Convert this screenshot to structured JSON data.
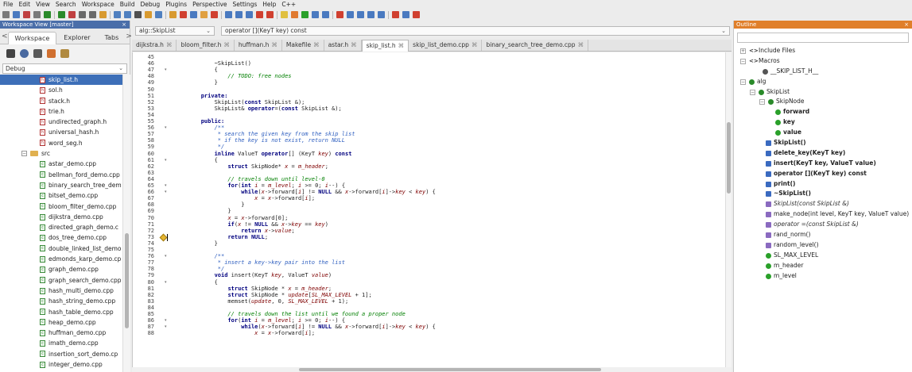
{
  "menubar": {
    "items": [
      "File",
      "Edit",
      "View",
      "Search",
      "Workspace",
      "Build",
      "Debug",
      "Plugins",
      "Perspective",
      "Settings",
      "Help",
      "C++"
    ]
  },
  "toolbar_colors": [
    "#7a7a7a",
    "#4a7ac0",
    "#c04040",
    "#7a7a7a",
    "#2a8a2a",
    "#2a8a2a",
    "#c04040",
    "#6a6a6a",
    "#6a6a6a",
    "#d89a30",
    "#5080c0",
    "#5080c0",
    "#505050",
    "#d89a30",
    "#5080c0",
    "#d89a30",
    "#d04030",
    "#4a7ac0",
    "#e0a040",
    "#d04030",
    "#4a7ac0",
    "#4a7ac0",
    "#4a7ac0",
    "#d04030",
    "#d04030",
    "#e0c040",
    "#e07a30",
    "#2aa02a",
    "#4a7ac0",
    "#4a7ac0",
    "#d04030",
    "#4a7ac0",
    "#4a7ac0",
    "#4a7ac0",
    "#4a7ac0",
    "#d04030",
    "#4a7ac0",
    "#d04030"
  ],
  "workspace": {
    "title": "Workspace View [master]",
    "close": "×",
    "tabs": [
      "Workspace",
      "Explorer",
      "Tabs"
    ],
    "tab_left_arrow": "<",
    "tab_right_arrow": ">",
    "config": "Debug",
    "tree": [
      {
        "kind": "h",
        "label": "skip_list.h",
        "indent": 50,
        "selected": true
      },
      {
        "kind": "h",
        "label": "sol.h",
        "indent": 50
      },
      {
        "kind": "h",
        "label": "stack.h",
        "indent": 50
      },
      {
        "kind": "h",
        "label": "trie.h",
        "indent": 50
      },
      {
        "kind": "h",
        "label": "undirected_graph.h",
        "indent": 50
      },
      {
        "kind": "h",
        "label": "universal_hash.h",
        "indent": 50
      },
      {
        "kind": "h",
        "label": "word_seg.h",
        "indent": 50
      },
      {
        "kind": "folder",
        "label": "src",
        "indent": 27,
        "expander": "−"
      },
      {
        "kind": "cpp",
        "label": "astar_demo.cpp",
        "indent": 50
      },
      {
        "kind": "cpp",
        "label": "bellman_ford_demo.cpp",
        "indent": 50
      },
      {
        "kind": "cpp",
        "label": "binary_search_tree_dem",
        "indent": 50
      },
      {
        "kind": "cpp",
        "label": "bitset_demo.cpp",
        "indent": 50
      },
      {
        "kind": "cpp",
        "label": "bloom_filter_demo.cpp",
        "indent": 50
      },
      {
        "kind": "cpp",
        "label": "dijkstra_demo.cpp",
        "indent": 50
      },
      {
        "kind": "cpp",
        "label": "directed_graph_demo.c",
        "indent": 50
      },
      {
        "kind": "cpp",
        "label": "dos_tree_demo.cpp",
        "indent": 50
      },
      {
        "kind": "cpp",
        "label": "double_linked_list_demo",
        "indent": 50
      },
      {
        "kind": "cpp",
        "label": "edmonds_karp_demo.cp",
        "indent": 50
      },
      {
        "kind": "cpp",
        "label": "graph_demo.cpp",
        "indent": 50
      },
      {
        "kind": "cpp",
        "label": "graph_search_demo.cpp",
        "indent": 50
      },
      {
        "kind": "cpp",
        "label": "hash_multi_demo.cpp",
        "indent": 50
      },
      {
        "kind": "cpp",
        "label": "hash_string_demo.cpp",
        "indent": 50
      },
      {
        "kind": "cpp",
        "label": "hash_table_demo.cpp",
        "indent": 50
      },
      {
        "kind": "cpp",
        "label": "heap_demo.cpp",
        "indent": 50
      },
      {
        "kind": "cpp",
        "label": "huffman_demo.cpp",
        "indent": 50
      },
      {
        "kind": "cpp",
        "label": "imath_demo.cpp",
        "indent": 50
      },
      {
        "kind": "cpp",
        "label": "insertion_sort_demo.cp",
        "indent": 50
      },
      {
        "kind": "cpp",
        "label": "integer_demo.cpp",
        "indent": 50
      }
    ]
  },
  "editor": {
    "scope": "alg::SkipList",
    "function": "operator [](KeyT key) const",
    "tabs": [
      {
        "label": "dijkstra.h"
      },
      {
        "label": "bloom_filter.h"
      },
      {
        "label": "huffman.h"
      },
      {
        "label": "Makefile"
      },
      {
        "label": "astar.h"
      },
      {
        "label": "skip_list.h",
        "active": true
      },
      {
        "label": "skip_list_demo.cpp"
      },
      {
        "label": "binary_search_tree_demo.cpp"
      }
    ],
    "tab_close": "⌘",
    "lines": [
      {
        "n": "45",
        "t": ""
      },
      {
        "n": "46",
        "t": "            ~SkipList()"
      },
      {
        "n": "47",
        "t": "            {",
        "fold": "▾"
      },
      {
        "n": "48",
        "t": "                // TODO: free nodes",
        "cls": "cm"
      },
      {
        "n": "49",
        "t": "            }"
      },
      {
        "n": "50",
        "t": ""
      },
      {
        "n": "51",
        "t": "        private:",
        "cls": "kw"
      },
      {
        "n": "52",
        "t": "            SkipList(const SkipList &);"
      },
      {
        "n": "53",
        "t": "            SkipList& operator=(const SkipList &);"
      },
      {
        "n": "54",
        "t": ""
      },
      {
        "n": "55",
        "t": "        public:",
        "cls": "kw"
      },
      {
        "n": "56",
        "t": "            /**",
        "cls": "cmt",
        "fold": "▾"
      },
      {
        "n": "57",
        "t": "             * search the given key from the skip list",
        "cls": "cmt"
      },
      {
        "n": "58",
        "t": "             * if the key is not exist, return NULL",
        "cls": "cmt"
      },
      {
        "n": "59",
        "t": "             */",
        "cls": "cmt"
      },
      {
        "n": "60",
        "t": "            inline ValueT operator[] (KeyT key) const"
      },
      {
        "n": "61",
        "t": "            {",
        "fold": "▾"
      },
      {
        "n": "62",
        "t": "                struct SkipNode* x = m_header;"
      },
      {
        "n": "63",
        "t": ""
      },
      {
        "n": "64",
        "t": "                // travels down until level-0",
        "cls": "cm"
      },
      {
        "n": "65",
        "t": "                for(int i = m_level; i >= 0; i--) {",
        "fold": "▾"
      },
      {
        "n": "66",
        "t": "                    while(x->forward[i] != NULL && x->forward[i]->key < key) {",
        "fold": "▾"
      },
      {
        "n": "67",
        "t": "                        x = x->forward[i];"
      },
      {
        "n": "68",
        "t": "                    }"
      },
      {
        "n": "69",
        "t": "                }"
      },
      {
        "n": "70",
        "t": "                x = x->forward[0];"
      },
      {
        "n": "71",
        "t": "                if(x != NULL && x->key == key)"
      },
      {
        "n": "72",
        "t": "                    return x->value;"
      },
      {
        "n": "73",
        "t": "                return NULL;",
        "bookmark": true
      },
      {
        "n": "74",
        "t": "            }"
      },
      {
        "n": "75",
        "t": ""
      },
      {
        "n": "76",
        "t": "            /**",
        "cls": "cmt",
        "fold": "▾"
      },
      {
        "n": "77",
        "t": "             * insert a key->key pair into the list",
        "cls": "cmt"
      },
      {
        "n": "78",
        "t": "             */",
        "cls": "cmt"
      },
      {
        "n": "79",
        "t": "            void insert(KeyT key, ValueT value)"
      },
      {
        "n": "80",
        "t": "            {",
        "fold": "▾"
      },
      {
        "n": "81",
        "t": "                struct SkipNode * x = m_header;"
      },
      {
        "n": "82",
        "t": "                struct SkipNode * update[SL_MAX_LEVEL + 1];"
      },
      {
        "n": "83",
        "t": "                memset(update, 0, SL_MAX_LEVEL + 1);"
      },
      {
        "n": "84",
        "t": ""
      },
      {
        "n": "85",
        "t": "                // travels down the list until we found a proper node",
        "cls": "cm"
      },
      {
        "n": "86",
        "t": "                for(int i = m_level; i >= 0; i--) {",
        "fold": "▾"
      },
      {
        "n": "87",
        "t": "                    while(x->forward[i] != NULL && x->forward[i]->key < key) {",
        "fold": "▾"
      },
      {
        "n": "88",
        "t": "                        x = x->forward[i];"
      }
    ]
  },
  "outline": {
    "title": "Outline",
    "close": "×",
    "items": [
      {
        "label": "Include Files",
        "indent": 8,
        "exp": "+",
        "icon": "code"
      },
      {
        "label": "Macros",
        "indent": 8,
        "exp": "−",
        "icon": "code"
      },
      {
        "label": "__SKIP_LIST_H__",
        "indent": 36,
        "icon": "macro",
        "color": "#555555"
      },
      {
        "label": "alg",
        "indent": 8,
        "exp": "−",
        "icon": "ns",
        "color": "#2a8a2a"
      },
      {
        "label": "SkipList",
        "indent": 20,
        "exp": "−",
        "icon": "class",
        "color": "#2a8a2a"
      },
      {
        "label": "SkipNode",
        "indent": 32,
        "exp": "−",
        "icon": "class",
        "color": "#2a8a2a"
      },
      {
        "label": "forward",
        "indent": 52,
        "icon": "member",
        "color": "#2aa02a",
        "style": "b"
      },
      {
        "label": "key",
        "indent": 52,
        "icon": "member",
        "color": "#2aa02a",
        "style": "b"
      },
      {
        "label": "value",
        "indent": 52,
        "icon": "member",
        "color": "#2aa02a",
        "style": "b"
      },
      {
        "label": "SkipList()",
        "indent": 40,
        "icon": "method",
        "color": "#3a6ac0",
        "style": "b"
      },
      {
        "label": "delete_key(KeyT key)",
        "indent": 40,
        "icon": "method",
        "color": "#3a6ac0",
        "style": "b"
      },
      {
        "label": "insert(KeyT key, ValueT value)",
        "indent": 40,
        "icon": "method",
        "color": "#3a6ac0",
        "style": "b"
      },
      {
        "label": "operator [](KeyT key) const",
        "indent": 40,
        "icon": "method",
        "color": "#3a6ac0",
        "style": "b"
      },
      {
        "label": "print()",
        "indent": 40,
        "icon": "method",
        "color": "#3a6ac0",
        "style": "b"
      },
      {
        "label": "~SkipList()",
        "indent": 40,
        "icon": "method",
        "color": "#3a6ac0",
        "style": "b"
      },
      {
        "label": "SkipList(const SkipList &)",
        "indent": 40,
        "icon": "method",
        "color": "#8a6ac0",
        "style": "i"
      },
      {
        "label": "make_node(int level, KeyT key, ValueT value)",
        "indent": 40,
        "icon": "method",
        "color": "#8a6ac0"
      },
      {
        "label": "operator =(const SkipList &)",
        "indent": 40,
        "icon": "method",
        "color": "#8a6ac0",
        "style": "i"
      },
      {
        "label": "rand_norm()",
        "indent": 40,
        "icon": "method",
        "color": "#8a6ac0"
      },
      {
        "label": "random_level()",
        "indent": 40,
        "icon": "method",
        "color": "#8a6ac0"
      },
      {
        "label": "SL_MAX_LEVEL",
        "indent": 40,
        "icon": "member",
        "color": "#2aa02a"
      },
      {
        "label": "m_header",
        "indent": 40,
        "icon": "member",
        "color": "#2aa02a"
      },
      {
        "label": "m_level",
        "indent": 40,
        "icon": "member",
        "color": "#2aa02a"
      }
    ]
  }
}
